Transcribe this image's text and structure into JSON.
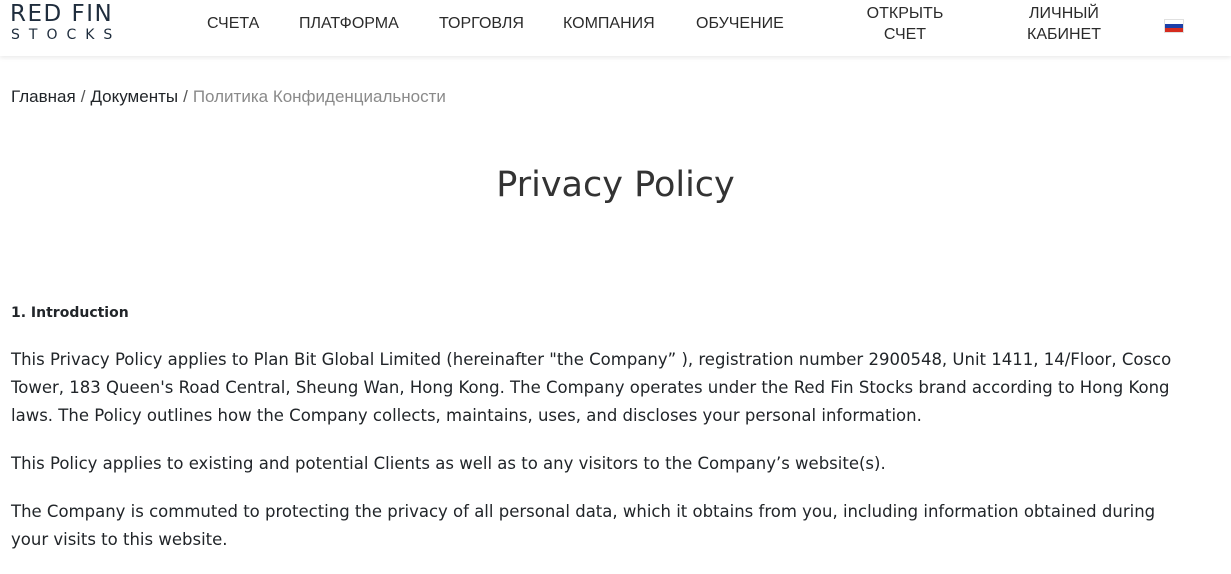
{
  "logo": {
    "top": "RED FIN",
    "bottom": "STOCKS"
  },
  "nav": {
    "accounts": "СЧЕТА",
    "platform": "ПЛАТФОРМА",
    "trading": "ТОРГОВЛЯ",
    "company": "КОМПАНИЯ",
    "education": "ОБУЧЕНИЕ",
    "open_account_1": "ОТКРЫТЬ",
    "open_account_2": "СЧЕТ",
    "cabinet_1": "ЛИЧНЫЙ",
    "cabinet_2": "КАБИНЕТ",
    "language_icon": "russia-flag-icon"
  },
  "breadcrumb": {
    "home": "Главная",
    "separator": "/",
    "documents": "Документы",
    "current": "Политика Конфиденциальности"
  },
  "page": {
    "title": "Privacy Policy",
    "section_heading": "1. Introduction",
    "paragraphs": [
      "This Privacy Policy applies to Plan Bit Global Limited (hereinafter \"the Company” ), registration number 2900548, Unit 1411, 14/Floor, Cosco Tower, 183 Queen's Road Central, Sheung Wan, Hong Kong. The Company operates under the Red Fin Stocks brand according to Hong Kong laws. The Policy outlines how the Company collects, maintains, uses, and discloses your personal information.",
      "This Policy applies to existing and potential Clients as well as to any visitors to the Company’s website(s).",
      "The Company is commuted to protecting the privacy of all personal data, which it obtains from you, including information obtained during your visits to this website."
    ]
  },
  "colors": {
    "flag_white": "#ffffff",
    "flag_blue": "#1c3fa8",
    "flag_red": "#d52b1e"
  }
}
